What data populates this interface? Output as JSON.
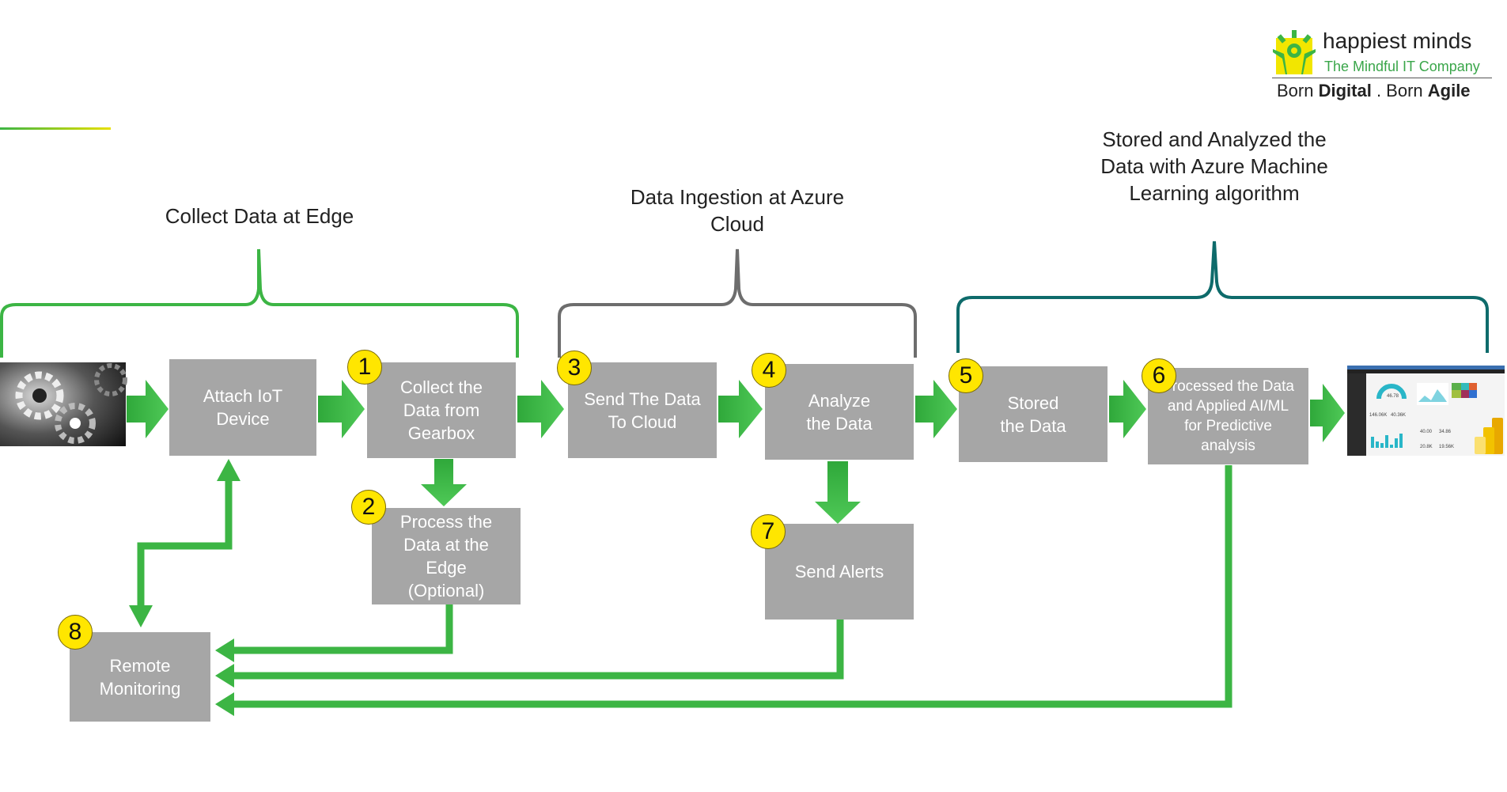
{
  "logo": {
    "brand": "happiest minds",
    "tagline": "The Mindful IT Company",
    "slogan_1": "Born ",
    "slogan_2": "Digital",
    "slogan_3": " . Born ",
    "slogan_4": "Agile"
  },
  "groups": {
    "edge": "Collect Data at Edge",
    "ingestion": "Data Ingestion at Azure Cloud",
    "storage": "Stored and Analyzed the Data with Azure Machine Learning algorithm"
  },
  "steps": {
    "attach": "Attach IoT Device",
    "collect": {
      "num": "1",
      "label": "Collect the Data from Gearbox"
    },
    "process": {
      "num": "2",
      "label": "Process the Data at the Edge (Optional)"
    },
    "send_cloud": {
      "num": "3",
      "label": "Send The Data To Cloud"
    },
    "analyze": {
      "num": "4",
      "label": "Analyze the Data"
    },
    "stored": {
      "num": "5",
      "label": "Stored the Data"
    },
    "processed": {
      "num": "6",
      "label": "Processed the Data and Applied AI/ML for Predictive analysis"
    },
    "alerts": {
      "num": "7",
      "label": "Send Alerts"
    },
    "remote": {
      "num": "8",
      "label": "Remote Monitoring"
    }
  },
  "dashboard": {
    "gauge": "46.78",
    "kpi1": "146.06K",
    "kpi2": "40.36K",
    "kpi3": "40.00",
    "kpi4": "34.86",
    "kpi5": "20.8K",
    "kpi6": "19.56K"
  },
  "colors": {
    "green": "#3cb544",
    "box": "#a6a6a6",
    "badge": "#ffe600",
    "gray_brace": "#6d6d6d",
    "teal_brace": "#0e6b6b"
  }
}
